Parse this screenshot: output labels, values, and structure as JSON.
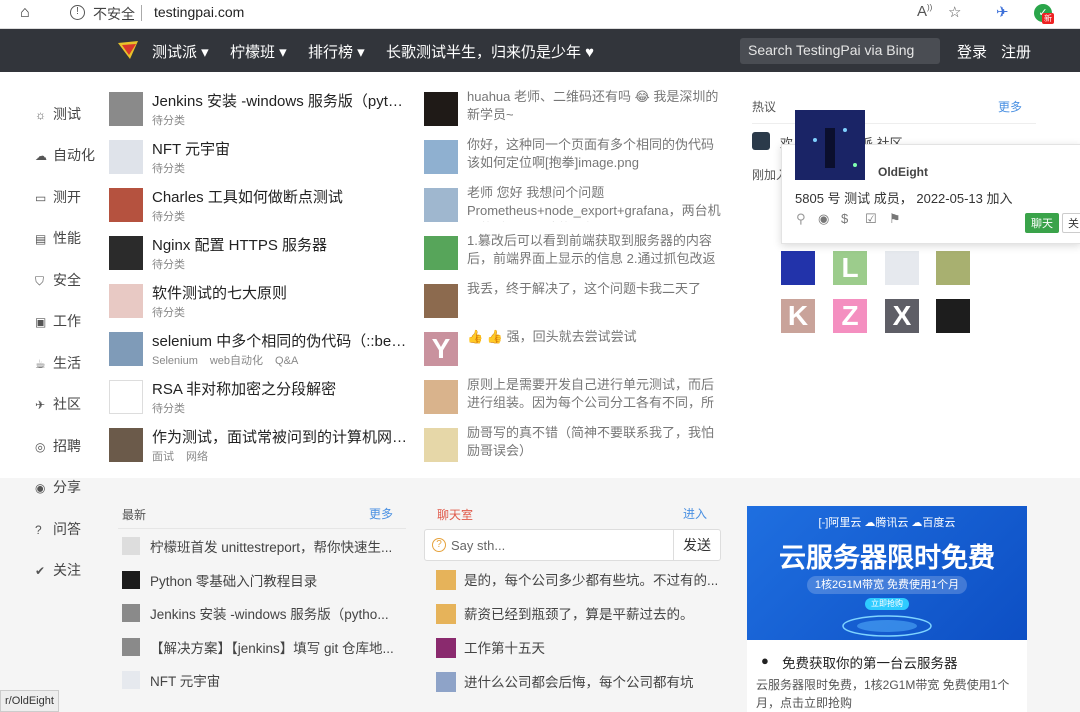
{
  "browser": {
    "insecure_label": "不安全",
    "url": "testingpai.com",
    "font_icon": "A",
    "badge_new": "新"
  },
  "nav": {
    "items": [
      "测试派 ▾",
      "柠檬班 ▾",
      "排行榜 ▾",
      "长歌测试半生，归来仍是少年 ♥"
    ],
    "search_placeholder": "Search TestingPai via Bing",
    "login": "登录",
    "register": "注册"
  },
  "sidebar": {
    "items": [
      {
        "label": "测试",
        "icon": "bug-icon",
        "glyph": "☼"
      },
      {
        "label": "自动化",
        "icon": "cloud-icon",
        "glyph": "☁"
      },
      {
        "label": "测开",
        "icon": "terminal-icon",
        "glyph": "▭"
      },
      {
        "label": "性能",
        "icon": "chart-icon",
        "glyph": "▤"
      },
      {
        "label": "安全",
        "icon": "shield-icon",
        "glyph": "⛉"
      },
      {
        "label": "工作",
        "icon": "briefcase-icon",
        "glyph": "▣"
      },
      {
        "label": "生活",
        "icon": "cup-icon",
        "glyph": "☕"
      },
      {
        "label": "社区",
        "icon": "paperplane-icon",
        "glyph": "✈"
      },
      {
        "label": "招聘",
        "icon": "target-icon",
        "glyph": "◎"
      },
      {
        "label": "分享",
        "icon": "share-icon",
        "glyph": "◉"
      },
      {
        "label": "问答",
        "icon": "question-icon",
        "glyph": "?"
      },
      {
        "label": "关注",
        "icon": "check-circle-icon",
        "glyph": "✔"
      }
    ]
  },
  "topics": [
    {
      "title": "Jenkins 安装 -windows 服务版（python 环境...",
      "meta": [
        "待分类"
      ],
      "avatar_color": "#8a8a8a"
    },
    {
      "title": "NFT 元宇宙",
      "meta": [
        "待分类"
      ],
      "avatar_color": "#dfe3ea"
    },
    {
      "title": "Charles 工具如何做断点测试",
      "meta": [
        "待分类"
      ],
      "avatar_color": "#b5523f"
    },
    {
      "title": "Nginx 配置 HTTPS 服务器",
      "meta": [
        "待分类"
      ],
      "avatar_color": "#2b2b2b"
    },
    {
      "title": "软件测试的七大原则",
      "meta": [
        "待分类"
      ],
      "avatar_color": "#e8c9c4"
    },
    {
      "title": "selenium 中多个相同的伪代码（::before）如何...",
      "meta": [
        "Selenium",
        "web自动化",
        "Q&A"
      ],
      "avatar_color": "#7f9bb8"
    },
    {
      "title": "RSA 非对称加密之分段解密",
      "meta": [
        "待分类"
      ],
      "avatar_color": "#ffffff"
    },
    {
      "title": "作为测试，面试常被问到的计算机网络知识",
      "meta": [
        "面试",
        "网络"
      ],
      "avatar_color": "#6b5a4a"
    }
  ],
  "replies": [
    {
      "text": "huahua 老师、二维码还有吗 😂 我是深圳的新学员~",
      "avatar_color": "#1f1a17",
      "letter": ""
    },
    {
      "text": "你好，这种同一个页面有多个相同的伪代码该如何定位啊[抱拳]image.png",
      "avatar_color": "#8fb0d0",
      "letter": ""
    },
    {
      "text": "老师 您好 我想问个问题 Prometheus+node_export+grafana，两台机器的时间是一致的，但是...",
      "avatar_color": "#9fb7cf",
      "letter": ""
    },
    {
      "text": "1.篡改后可以看到前端获取到服务器的内容后，前端界面上显示的信息 2.通过抓包改返回...",
      "avatar_color": "#57a55a",
      "letter": ""
    },
    {
      "text": "我丢，终于解决了，这个问题卡我二天了",
      "avatar_color": "#8c6a4e",
      "letter": ""
    },
    {
      "text": "👍 👍 强，回头就去尝试尝试",
      "avatar_color": "#c9929e",
      "letter": "Y"
    },
    {
      "text": "原则上是需要开发自己进行单元测试，而后进行组装。因为每个公司分工各有不同，所以...",
      "avatar_color": "#d9b38c",
      "letter": ""
    },
    {
      "text": "励哥写的真不错（简神不要联系我了，我怕励哥误会）",
      "avatar_color": "#e6d7a8",
      "letter": ""
    }
  ],
  "hot": {
    "title": "热议",
    "more": "更多",
    "row1_text": "欢",
    "row1_suffix": "派 社区",
    "row2_text": "刚加入"
  },
  "popup": {
    "name": "OldEight",
    "info": "5805 号 测试 成员， 2022-05-13 加入",
    "chat_btn": "聊天",
    "follow_btn": "关"
  },
  "member_avatars": [
    {
      "letter": "",
      "color": "#2233aa"
    },
    {
      "letter": "L",
      "color": "#9ccc8c"
    },
    {
      "letter": "",
      "color": "#e6e9ee"
    },
    {
      "letter": "",
      "color": "#a8b070"
    },
    {
      "letter": "K",
      "color": "#c9a39a"
    },
    {
      "letter": "Z",
      "color": "#f48fc0"
    },
    {
      "letter": "X",
      "color": "#5e5e66"
    },
    {
      "letter": "",
      "color": "#1d1d1d"
    }
  ],
  "latest": {
    "title": "最新",
    "more": "更多",
    "items": [
      {
        "text": "柠檬班首发 unittestreport，帮你快速生...",
        "color": "#dddddd"
      },
      {
        "text": "Python 零基础入门教程目录",
        "color": "#1b1b1b"
      },
      {
        "text": "Jenkins 安装 -windows 服务版（pytho...",
        "color": "#8a8a8a"
      },
      {
        "text": "【解决方案】【jenkins】填写 git 仓库地...",
        "color": "#8a8a8a"
      },
      {
        "text": "NFT 元宇宙",
        "color": "#e6e9ee"
      }
    ]
  },
  "chatroom": {
    "title": "聊天室",
    "enter": "进入",
    "input_placeholder": "Say sth...",
    "send": "发送",
    "items": [
      {
        "text": "是的，每个公司多少都有些坑。不过有的...",
        "color": "#e6b35a"
      },
      {
        "text": "薪资已经到瓶颈了，算是平薪过去的。",
        "color": "#e6b35a"
      },
      {
        "text": "工作第十五天",
        "color": "#8a2a6e"
      },
      {
        "text": "进什么公司都会后悔，每个公司都有坑",
        "color": "#8ea3c8"
      }
    ]
  },
  "ad": {
    "brand_text": "[-]阿里云  ☁腾讯云  ☁百度云",
    "headline": "云服务器限时免费",
    "sub": "1核2G1M带宽 免费使用1个月",
    "btn": "立即抢购",
    "title": "免费获取你的第一台云服务器",
    "desc": "云服务器限时免费，1核2G1M带宽 免费使用1个月，点击立即抢购"
  },
  "status_tooltip": "r/OldEight"
}
